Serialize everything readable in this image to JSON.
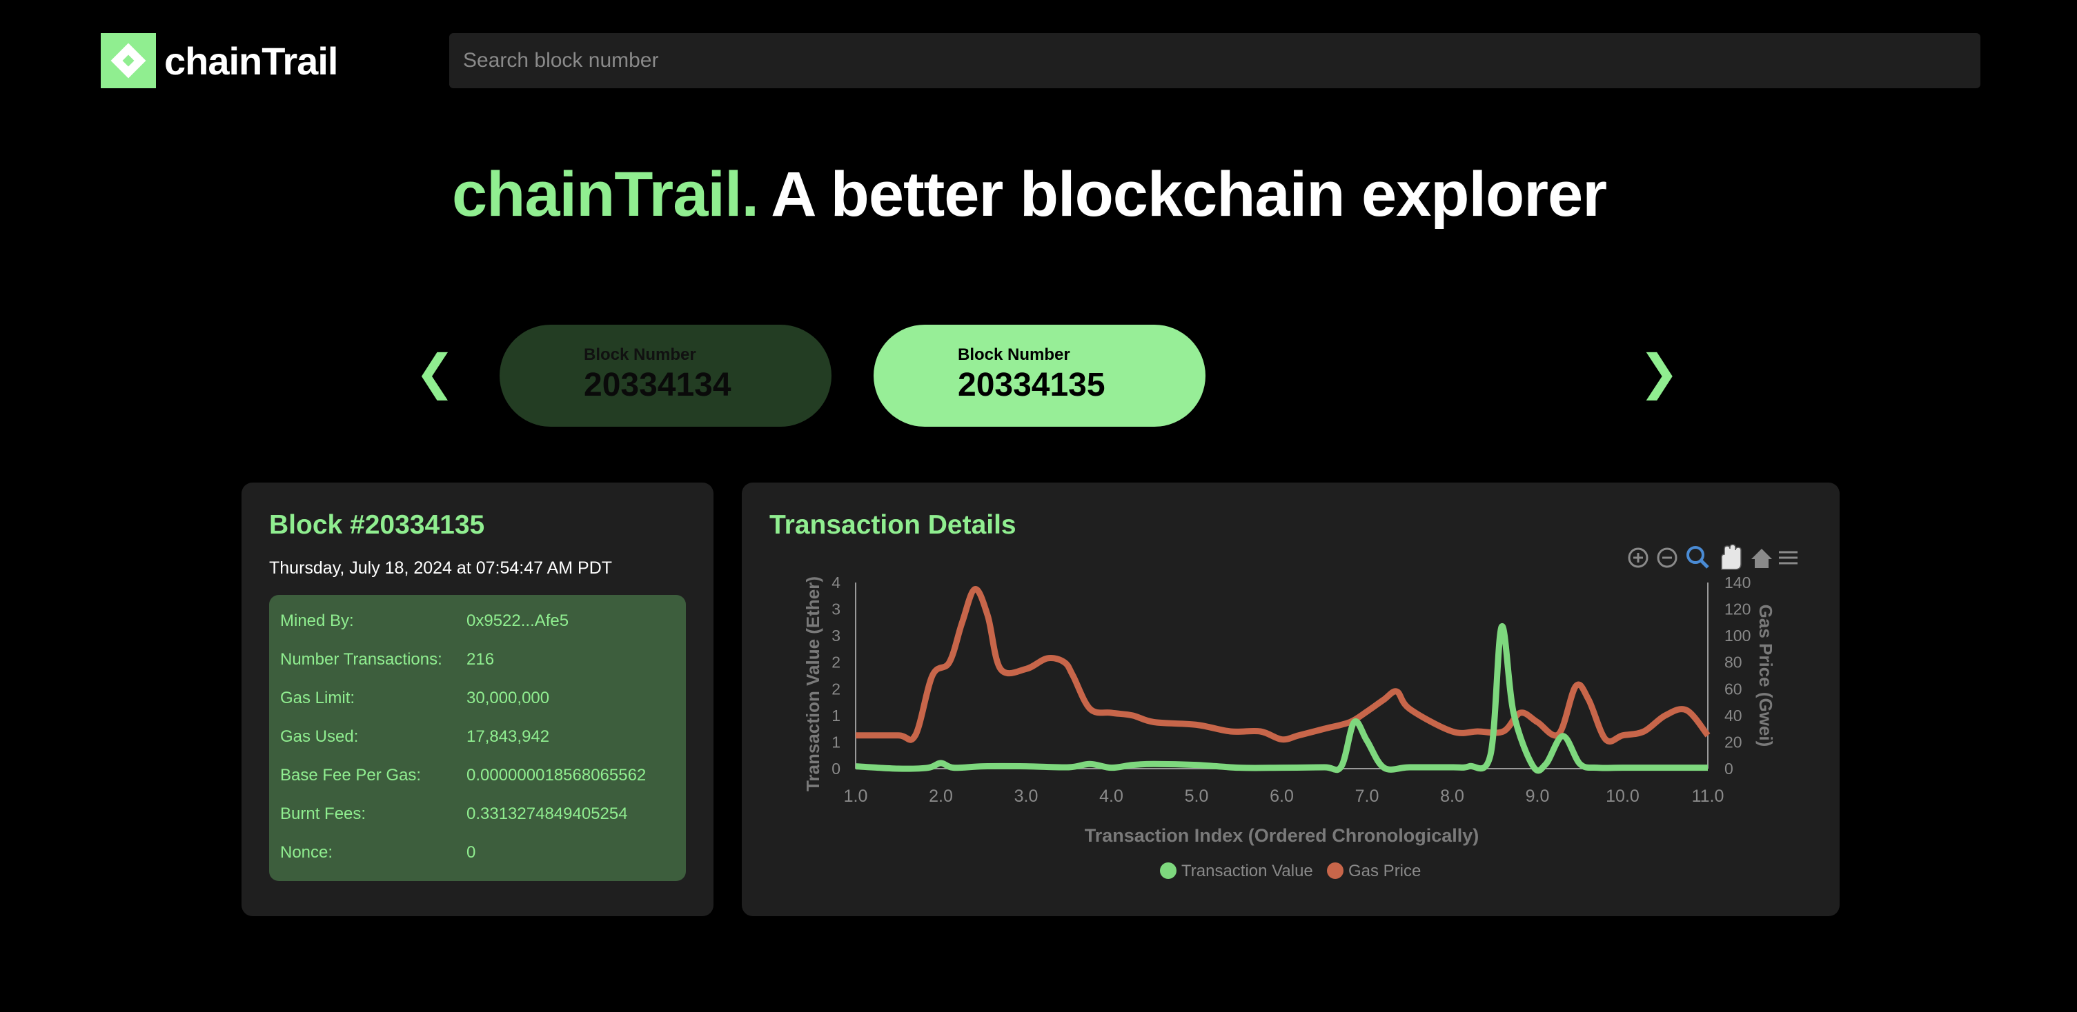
{
  "header": {
    "logo_text": "chainTrail",
    "search_placeholder": "Search block number"
  },
  "hero": {
    "brand": "chainTrail.",
    "tagline": "A better blockchain explorer"
  },
  "carousel": {
    "prev_arrow": "❮",
    "next_arrow": "❯",
    "blocks": [
      {
        "label": "Block Number",
        "number": "20334134"
      },
      {
        "label": "Block Number",
        "number": "20334135"
      }
    ]
  },
  "block_card": {
    "title": "Block #20334135",
    "timestamp": "Thursday, July 18, 2024 at 07:54:47 AM PDT",
    "rows": [
      {
        "key": "Mined By:",
        "value": "0x9522...Afe5"
      },
      {
        "key": "Number Transactions:",
        "value": "216"
      },
      {
        "key": "Gas Limit:",
        "value": "30,000,000"
      },
      {
        "key": "Gas Used:",
        "value": "17,843,942"
      },
      {
        "key": "Base Fee Per Gas:",
        "value": "0.000000018568065562"
      },
      {
        "key": "Burnt Fees:",
        "value": "0.3313274849405254"
      },
      {
        "key": "Nonce:",
        "value": "0"
      }
    ]
  },
  "tx_card": {
    "title": "Transaction Details",
    "toolbar": [
      "zoom-in-icon",
      "zoom-out-icon",
      "selection-zoom-icon",
      "pan-hand-icon",
      "home-reset-icon",
      "menu-icon"
    ]
  },
  "chart_data": {
    "type": "line",
    "xlabel": "Transaction Index (Ordered Chronologically)",
    "ylabel_left": "Transaction Value (Ether)",
    "ylabel_right": "Gas Price (Gwei)",
    "xlim": [
      1.0,
      11.0
    ],
    "ylim_left": [
      0,
      4
    ],
    "ylim_right": [
      0,
      140
    ],
    "x_ticks": [
      "1.0",
      "2.0",
      "3.0",
      "4.0",
      "5.0",
      "6.0",
      "7.0",
      "8.0",
      "9.0",
      "10.0",
      "11.0"
    ],
    "y_ticks_left": [
      "0",
      "1",
      "1",
      "2",
      "2",
      "3",
      "3",
      "4"
    ],
    "y_ticks_right": [
      "0",
      "20",
      "40",
      "60",
      "80",
      "100",
      "120",
      "140"
    ],
    "colors": {
      "Transaction Value": "#7ed87e",
      "Gas Price": "#c8664a"
    },
    "series": [
      {
        "name": "Transaction Value",
        "x": [
          1.0,
          1.5,
          1.85,
          2.0,
          2.15,
          2.5,
          3.0,
          3.5,
          3.75,
          4.0,
          4.25,
          4.5,
          5.0,
          5.5,
          6.0,
          6.5,
          6.7,
          6.85,
          7.0,
          7.2,
          7.5,
          8.0,
          8.2,
          8.45,
          8.58,
          8.72,
          8.95,
          9.1,
          9.3,
          9.5,
          9.7,
          10.0,
          10.5,
          11.0
        ],
        "y": [
          0.05,
          0.0,
          0.02,
          0.12,
          0.02,
          0.05,
          0.05,
          0.03,
          0.1,
          0.02,
          0.08,
          0.1,
          0.08,
          0.02,
          0.02,
          0.03,
          0.05,
          1.0,
          0.6,
          0.02,
          0.03,
          0.03,
          0.05,
          0.3,
          3.05,
          1.2,
          0.05,
          0.1,
          0.7,
          0.1,
          0.02,
          0.02,
          0.02,
          0.02
        ]
      },
      {
        "name": "Gas Price",
        "x": [
          1.0,
          1.5,
          1.7,
          1.9,
          2.1,
          2.25,
          2.4,
          2.55,
          2.7,
          3.0,
          3.25,
          3.45,
          3.55,
          3.75,
          4.0,
          4.25,
          4.5,
          5.0,
          5.4,
          5.75,
          6.0,
          6.2,
          6.5,
          6.8,
          7.0,
          7.2,
          7.35,
          7.5,
          8.0,
          8.3,
          8.6,
          8.8,
          9.0,
          9.25,
          9.45,
          9.6,
          9.8,
          10.0,
          10.25,
          10.5,
          10.75,
          11.0
        ],
        "y": [
          25,
          25,
          25,
          70,
          80,
          110,
          135,
          115,
          75,
          75,
          83,
          80,
          70,
          45,
          42,
          40,
          35,
          33,
          28,
          28,
          22,
          25,
          30,
          35,
          43,
          52,
          58,
          45,
          28,
          28,
          28,
          42,
          35,
          26,
          62,
          52,
          22,
          25,
          28,
          40,
          44,
          25
        ]
      }
    ],
    "legend": "bottom-center"
  }
}
